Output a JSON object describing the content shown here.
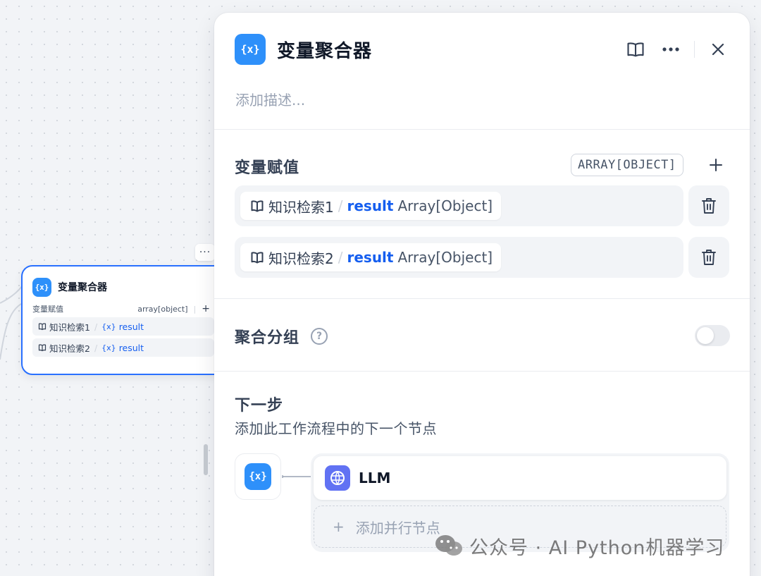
{
  "canvas_node": {
    "title": "变量聚合器",
    "icon": "variable-icon",
    "more": "···",
    "var_label": "变量赋值",
    "var_type": "array[object]",
    "add": "+",
    "items": [
      {
        "source": "知识检索1",
        "sep": "/",
        "var_icon": "{x}",
        "var": "result"
      },
      {
        "source": "知识检索2",
        "sep": "/",
        "var_icon": "{x}",
        "var": "result"
      }
    ]
  },
  "panel": {
    "title": "变量聚合器",
    "icon": "{x}",
    "description_placeholder": "添加描述...",
    "actions": [
      "book-icon",
      "more-icon",
      "close-icon"
    ],
    "assign": {
      "title": "变量赋值",
      "type": "ARRAY[OBJECT]",
      "items": [
        {
          "source": "知识检索1",
          "sep": "/",
          "var": "result",
          "type": "Array[Object]"
        },
        {
          "source": "知识检索2",
          "sep": "/",
          "var": "result",
          "type": "Array[Object]"
        }
      ]
    },
    "group": {
      "title": "聚合分组",
      "help": "?",
      "enabled": false
    },
    "next": {
      "title": "下一步",
      "subtitle": "添加此工作流程中的下一个节点",
      "node": "LLM",
      "add_parallel": "添加并行节点",
      "add_icon": "+"
    }
  },
  "watermark": "公众号 · AI Python机器学习",
  "colors": {
    "accent": "#2970ff",
    "icon_blue": "#2e90fa",
    "llm": "#6172f3",
    "var": "#155eef"
  }
}
